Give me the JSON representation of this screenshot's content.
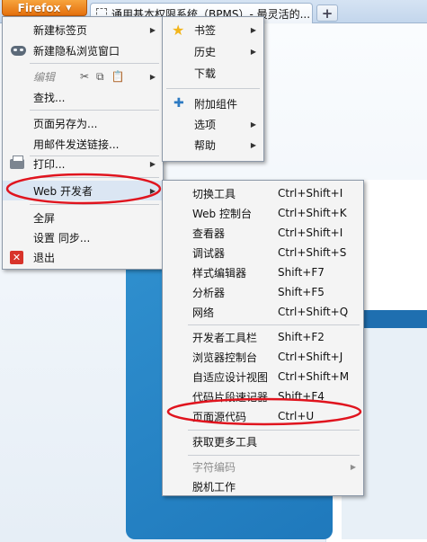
{
  "browser": {
    "firefox_button_label": "Firefox",
    "tab_title": "通用基本权限系统（BPMS）- 最灵活的...",
    "new_tab_symbol": "+"
  },
  "main_menu": {
    "new_tab": "新建标签页",
    "new_private_window": "新建隐私浏览窗口",
    "edit": "编辑",
    "find": "查找...",
    "save_page_as": "页面另存为...",
    "send_link": "用邮件发送链接...",
    "print": "打印...",
    "web_developer": "Web 开发者",
    "fullscreen": "全屏",
    "setup_sync": "设置 同步...",
    "exit": "退出"
  },
  "right_menu": {
    "bookmarks": "书签",
    "history": "历史",
    "downloads": "下载",
    "addons": "附加组件",
    "options": "选项",
    "help": "帮助"
  },
  "webdev_menu": {
    "items": [
      {
        "label": "切换工具",
        "shortcut": "Ctrl+Shift+I"
      },
      {
        "label": "Web 控制台",
        "shortcut": "Ctrl+Shift+K"
      },
      {
        "label": "查看器",
        "shortcut": "Ctrl+Shift+I"
      },
      {
        "label": "调试器",
        "shortcut": "Ctrl+Shift+S"
      },
      {
        "label": "样式编辑器",
        "shortcut": "Shift+F7"
      },
      {
        "label": "分析器",
        "shortcut": "Shift+F5"
      },
      {
        "label": "网络",
        "shortcut": "Ctrl+Shift+Q"
      },
      {
        "label": "开发者工具栏",
        "shortcut": "Shift+F2"
      },
      {
        "label": "浏览器控制台",
        "shortcut": "Ctrl+Shift+J"
      },
      {
        "label": "自适应设计视图",
        "shortcut": "Ctrl+Shift+M"
      },
      {
        "label": "代码片段速记器",
        "shortcut": "Shift+F4"
      },
      {
        "label": "页面源代码",
        "shortcut": "Ctrl+U"
      },
      {
        "label": "获取更多工具",
        "shortcut": ""
      },
      {
        "label": "字符编码",
        "shortcut": ""
      },
      {
        "label": "脱机工作",
        "shortcut": ""
      }
    ]
  },
  "colors": {
    "firefox_orange": "#e4700d",
    "annotation_red": "#e0141e",
    "menu_highlight": "#dbe6f3"
  }
}
